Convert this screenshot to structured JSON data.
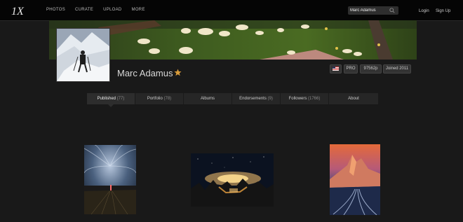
{
  "header": {
    "logo_text": "1X",
    "nav": [
      "PHOTOS",
      "CURATE",
      "UPLOAD",
      "MORE"
    ],
    "search_value": "Marc Adamus",
    "login": "Login",
    "signup": "Sign Up"
  },
  "profile": {
    "name": "Marc Adamus",
    "badges": {
      "flag": "us-flag-icon",
      "pro": "PRO",
      "points": "97562p",
      "joined": "Joined 2011"
    }
  },
  "tabs": [
    {
      "label": "Published",
      "count": "(77)",
      "active": true
    },
    {
      "label": "Portfolio",
      "count": "(78)",
      "active": false
    },
    {
      "label": "Albums",
      "count": "",
      "active": false
    },
    {
      "label": "Endorsements",
      "count": "(9)",
      "active": false
    },
    {
      "label": "Followers",
      "count": "(1766)",
      "active": false
    },
    {
      "label": "About",
      "count": "",
      "active": false
    }
  ],
  "photos": [
    {
      "subject": "storm-lightning-field"
    },
    {
      "subject": "night-storm-mountains"
    },
    {
      "subject": "mountain-river-sunset"
    }
  ],
  "colors": {
    "background": "#191919",
    "topbar": "#050505",
    "tab_bar": "#262626",
    "star": "#d89b3a"
  }
}
